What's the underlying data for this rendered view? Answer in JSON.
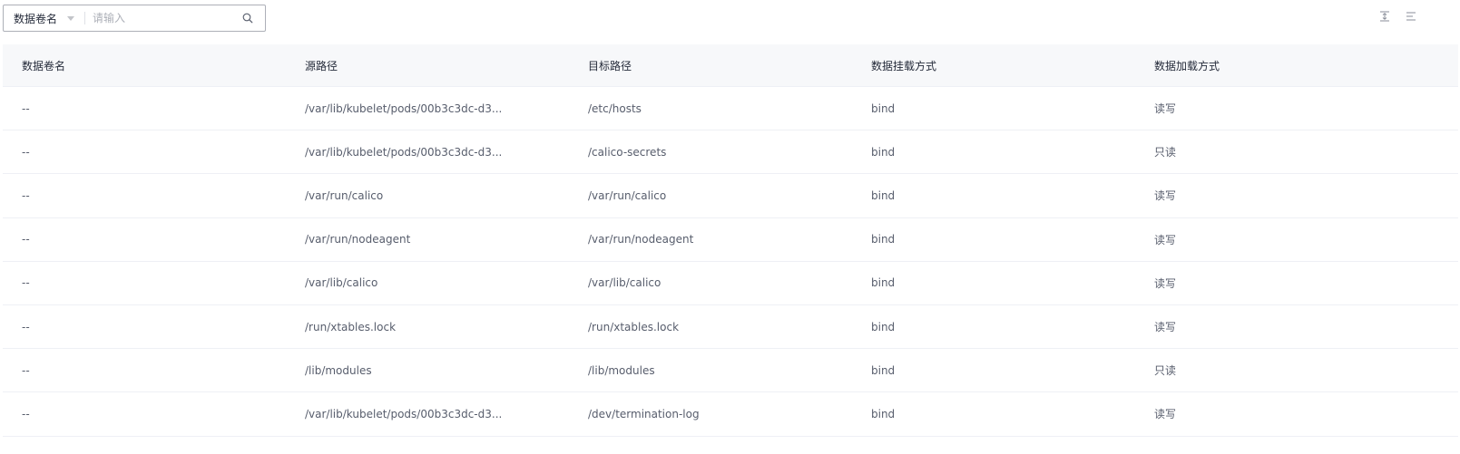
{
  "search": {
    "filter_label": "数据卷名",
    "placeholder": "请输入"
  },
  "toolbar_icons": [
    "expand-collapse-icon",
    "column-settings-icon"
  ],
  "table": {
    "columns": [
      "数据卷名",
      "源路径",
      "目标路径",
      "数据挂载方式",
      "数据加载方式"
    ],
    "rows": [
      [
        "--",
        "/var/lib/kubelet/pods/00b3c3dc-d3...",
        "/etc/hosts",
        "bind",
        "读写"
      ],
      [
        "--",
        "/var/lib/kubelet/pods/00b3c3dc-d3...",
        "/calico-secrets",
        "bind",
        "只读"
      ],
      [
        "--",
        "/var/run/calico",
        "/var/run/calico",
        "bind",
        "读写"
      ],
      [
        "--",
        "/var/run/nodeagent",
        "/var/run/nodeagent",
        "bind",
        "读写"
      ],
      [
        "--",
        "/var/lib/calico",
        "/var/lib/calico",
        "bind",
        "读写"
      ],
      [
        "--",
        "/run/xtables.lock",
        "/run/xtables.lock",
        "bind",
        "读写"
      ],
      [
        "--",
        "/lib/modules",
        "/lib/modules",
        "bind",
        "只读"
      ],
      [
        "--",
        "/var/lib/kubelet/pods/00b3c3dc-d3...",
        "/dev/termination-log",
        "bind",
        "读写"
      ]
    ]
  }
}
